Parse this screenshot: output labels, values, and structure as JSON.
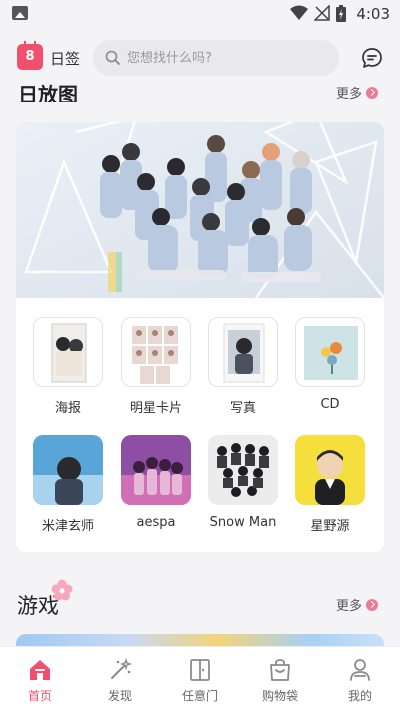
{
  "status_bar": {
    "time": "4:03"
  },
  "header": {
    "calendar_day": "8",
    "sign_label": "日签",
    "search_placeholder": "您想找什么吗?"
  },
  "section1": {
    "title": "日放图",
    "more": "更多"
  },
  "categories": [
    {
      "label": "海报",
      "icon": "poster-thumbnail"
    },
    {
      "label": "明星卡片",
      "icon": "star-card-thumbnail"
    },
    {
      "label": "写真",
      "icon": "photo-thumbnail"
    },
    {
      "label": "CD",
      "icon": "cd-thumbnail"
    },
    {
      "label": "米津玄师",
      "icon": "artist-thumbnail"
    },
    {
      "label": "aespa",
      "icon": "artist-thumbnail"
    },
    {
      "label": "Snow Man",
      "icon": "artist-thumbnail"
    },
    {
      "label": "星野源",
      "icon": "artist-thumbnail"
    }
  ],
  "section2": {
    "title": "游戏",
    "more": "更多"
  },
  "bottom_nav": [
    {
      "label": "首页",
      "icon": "home-icon",
      "active": true
    },
    {
      "label": "发现",
      "icon": "magic-wand-icon",
      "active": false
    },
    {
      "label": "任意门",
      "icon": "door-icon",
      "active": false
    },
    {
      "label": "购物袋",
      "icon": "shopping-bag-icon",
      "active": false
    },
    {
      "label": "我的",
      "icon": "profile-icon",
      "active": false
    }
  ],
  "colors": {
    "accent": "#f0506e",
    "background": "#f4f4f6"
  }
}
